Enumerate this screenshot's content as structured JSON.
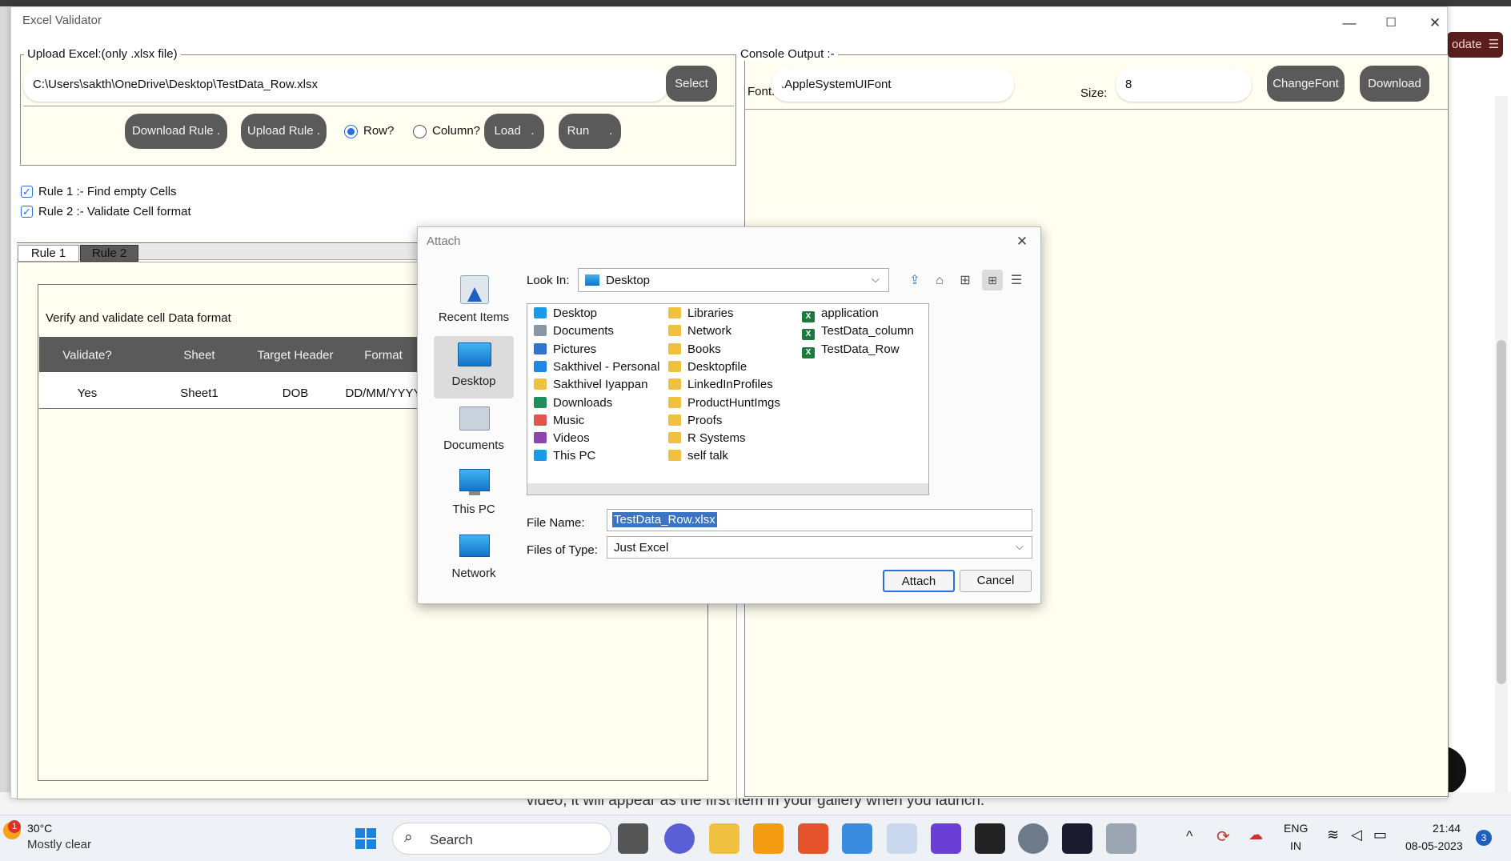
{
  "background": {
    "update_label": "odate",
    "bottom_text": "video, it will appear as the first item in your gallery when you launch."
  },
  "window": {
    "title": "Excel Validator",
    "controls": {
      "minimize": "—",
      "maximize": "☐",
      "close": "✕"
    }
  },
  "upload": {
    "legend": "Upload Excel:(only .xlsx file)",
    "path_value": "C:\\Users\\sakth\\OneDrive\\Desktop\\TestData_Row.xlsx",
    "select_label": "Select",
    "download_rule_label": "Download Rule .",
    "upload_rule_label": "Upload Rule .",
    "row_label": "Row?",
    "column_label": "Column?",
    "row_selected": true,
    "load_label": "Load   .",
    "run_label": "Run      ."
  },
  "rules": [
    {
      "label": "Rule 1 :- Find empty Cells",
      "checked": true
    },
    {
      "label": "Rule 2 :- Validate Cell format",
      "checked": true
    }
  ],
  "tabs": [
    {
      "label": "Rule 1",
      "active": false
    },
    {
      "label": "Rule 2",
      "active": true
    }
  ],
  "rule_panel": {
    "description": "Verify and validate cell Data format",
    "columns": [
      "Validate?",
      "Sheet",
      "Target Header",
      "Format"
    ],
    "rows": [
      [
        "Yes",
        "Sheet1",
        "DOB",
        "DD/MM/YYYY"
      ]
    ]
  },
  "console": {
    "legend": "Console Output :-",
    "font_label": "Font:",
    "font_value": ".AppleSystemUIFont",
    "size_label": "Size:",
    "size_value": "8",
    "change_font_label": "ChangeFont",
    "download_label": "Download"
  },
  "dialog": {
    "title": "Attach",
    "close": "✕",
    "look_in_label": "Look In:",
    "look_in_value": "Desktop",
    "places": [
      "Recent Items",
      "Desktop",
      "Documents",
      "This PC",
      "Network"
    ],
    "selected_place": "Desktop",
    "files_col1": [
      "Desktop",
      "Documents",
      "Pictures",
      "Sakthivel - Personal",
      "Sakthivel Iyappan",
      "Downloads",
      "Music",
      "Videos",
      "This PC"
    ],
    "files_col2": [
      "Libraries",
      "Network",
      "Books",
      "Desktopfile",
      "LinkedInProfiles",
      "ProductHuntImgs",
      "Proofs",
      "R Systems",
      "self talk"
    ],
    "files_col3": [
      "application",
      "TestData_column",
      "TestData_Row"
    ],
    "file_name_label": "File Name:",
    "file_name_value": "TestData_Row.xlsx",
    "file_type_label": "Files of Type:",
    "file_type_value": "Just Excel",
    "attach_label": "Attach",
    "cancel_label": "Cancel"
  },
  "taskbar": {
    "weather_temp": "30°C",
    "weather_desc": "Mostly clear",
    "weather_badge": "1",
    "search_label": "Search",
    "lang_1": "ENG",
    "lang_2": "IN",
    "time": "21:44",
    "date": "08-05-2023",
    "notif_count": "3"
  },
  "colors": {
    "accent": "#2a6fdb",
    "pill": "#5a5a5a",
    "panel_bg": "#fffef0",
    "table_header": "#5a5a5a"
  }
}
